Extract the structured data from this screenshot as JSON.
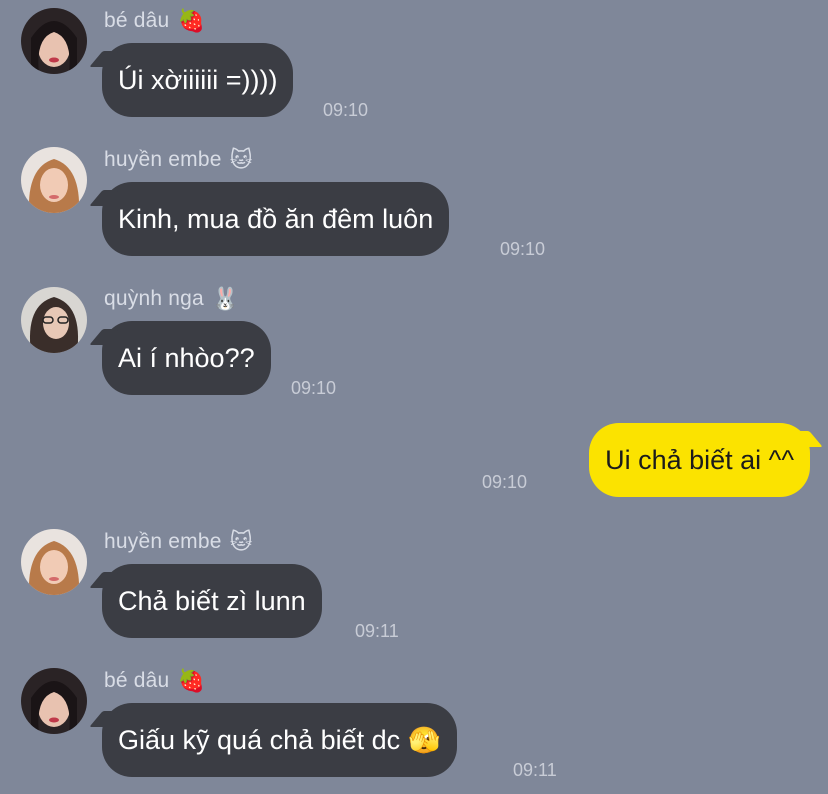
{
  "colors": {
    "background": "#7f8799",
    "incoming_bubble": "#3b3d44",
    "outgoing_bubble": "#fbe300",
    "name_text": "#d9dde6",
    "time_text": "#c8ccd6"
  },
  "messages": [
    {
      "sender": "bé dâu",
      "sender_emoji": "🍓",
      "text": "Úi xờiiiiii =))))",
      "time": "09:10",
      "avatar_icon": "avatar-be-dau-icon"
    },
    {
      "sender": "huyền embe",
      "sender_emoji": "🐱",
      "text": "Kinh, mua đồ ăn đêm luôn",
      "time": "09:10",
      "avatar_icon": "avatar-huyen-embe-icon"
    },
    {
      "sender": "quỳnh nga",
      "sender_emoji": "🐰",
      "text": "Ai í nhòo??",
      "time": "09:10",
      "avatar_icon": "avatar-quynh-nga-icon"
    },
    {
      "sender": "me",
      "text": "Ui chả biết ai ^^",
      "time": "09:10"
    },
    {
      "sender": "huyền embe",
      "sender_emoji": "🐱",
      "text": "Chả biết zì lunn",
      "time": "09:11",
      "avatar_icon": "avatar-huyen-embe-icon"
    },
    {
      "sender": "bé dâu",
      "sender_emoji": "🍓",
      "text": "Giấu kỹ quá chả biết dc",
      "text_emoji": "🫣",
      "time": "09:11",
      "avatar_icon": "avatar-be-dau-icon"
    }
  ]
}
